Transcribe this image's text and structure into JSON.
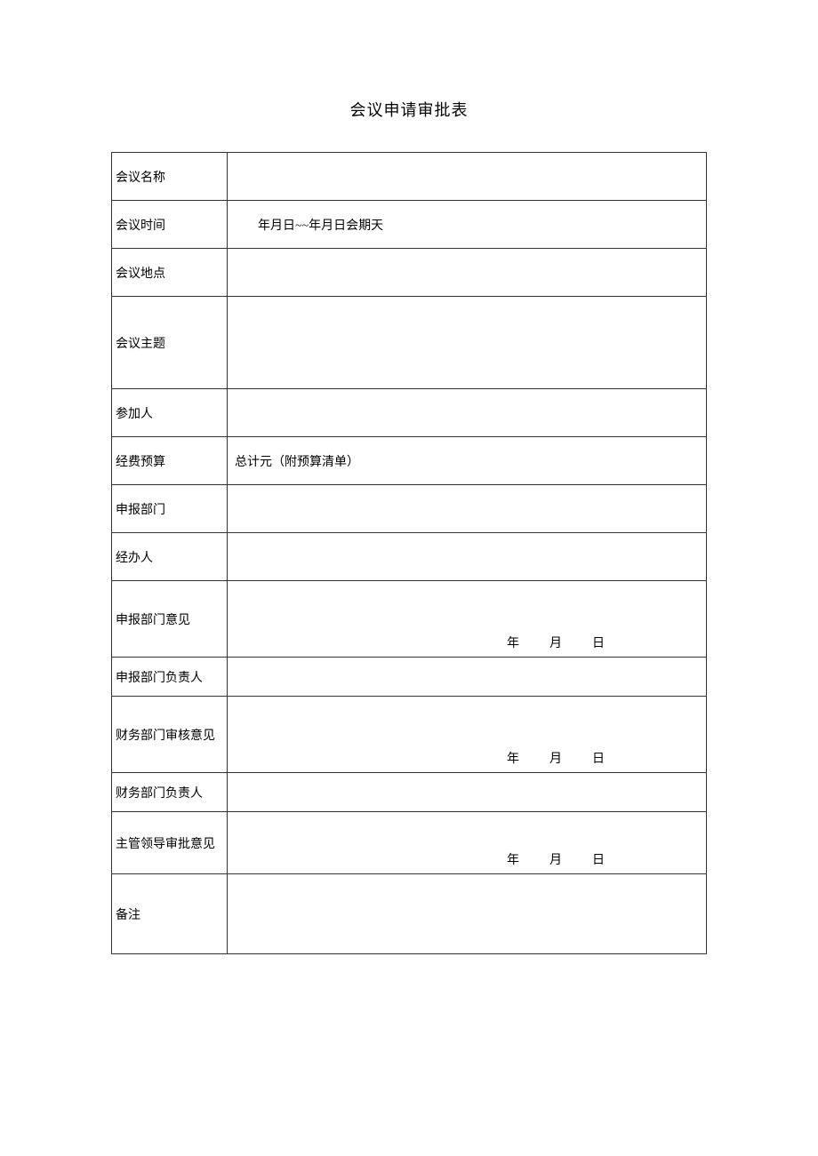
{
  "title": "会议申请审批表",
  "rows": {
    "meeting_name": {
      "label": "会议名称",
      "value": ""
    },
    "meeting_time": {
      "label": "会议时间",
      "value": "年月日~~年月日会期天"
    },
    "meeting_location": {
      "label": "会议地点",
      "value": ""
    },
    "meeting_topic": {
      "label": "会议主题",
      "value": ""
    },
    "attendees": {
      "label": "参加人",
      "value": ""
    },
    "budget": {
      "label": "经费预算",
      "value": "总计元（附预算清单）"
    },
    "report_dept": {
      "label": "申报部门",
      "value": ""
    },
    "handler": {
      "label": "经办人",
      "value": ""
    },
    "report_dept_opinion": {
      "label": "申报部门意见",
      "date": "年　月　日"
    },
    "report_dept_leader": {
      "label": "申报部门负责人",
      "value": ""
    },
    "finance_opinion": {
      "label": "财务部门审核意见",
      "date": "年　月　日"
    },
    "finance_leader": {
      "label": "财务部门负责人",
      "value": ""
    },
    "supervisor_opinion": {
      "label": "主管领导审批意见",
      "date": "年　月　日"
    },
    "remarks": {
      "label": "备注",
      "value": ""
    }
  }
}
